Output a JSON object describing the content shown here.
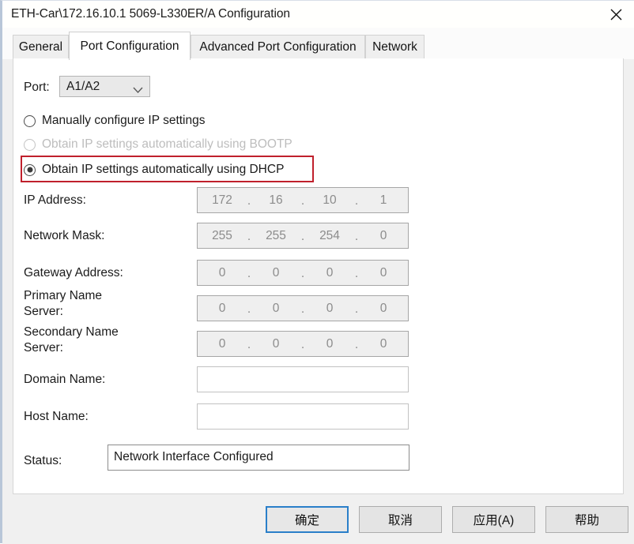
{
  "window": {
    "title": "ETH-Car\\172.16.10.1 5069-L330ER/A Configuration",
    "close_icon": "close-icon"
  },
  "tabs": [
    {
      "label": "General",
      "active": false
    },
    {
      "label": "Port Configuration",
      "active": true
    },
    {
      "label": "Advanced Port Configuration",
      "active": false
    },
    {
      "label": "Network",
      "active": false
    }
  ],
  "port": {
    "label": "Port:",
    "value": "A1/A2",
    "dropdown_icon": "chevron-down-icon"
  },
  "ip_mode": {
    "options": [
      {
        "label": "Manually configure IP settings",
        "selected": false,
        "disabled": false
      },
      {
        "label": "Obtain IP settings automatically using BOOTP",
        "selected": false,
        "disabled": true
      },
      {
        "label": "Obtain IP settings automatically using DHCP",
        "selected": true,
        "disabled": false
      }
    ],
    "highlight_color": "#c0202c"
  },
  "fields": {
    "ip_address": {
      "label": "IP Address:",
      "octets": [
        "172",
        "16",
        "10",
        "1"
      ],
      "readonly": true
    },
    "network_mask": {
      "label": "Network Mask:",
      "octets": [
        "255",
        "255",
        "254",
        "0"
      ],
      "readonly": true
    },
    "gateway_address": {
      "label": "Gateway Address:",
      "octets": [
        "0",
        "0",
        "0",
        "0"
      ],
      "readonly": true
    },
    "primary_name_server": {
      "label": "Primary Name\nServer:",
      "label_line1": "Primary Name",
      "label_line2": "Server:",
      "octets": [
        "0",
        "0",
        "0",
        "0"
      ],
      "readonly": true
    },
    "secondary_name_server": {
      "label_line1": "Secondary Name",
      "label_line2": "Server:",
      "octets": [
        "0",
        "0",
        "0",
        "0"
      ],
      "readonly": true
    },
    "domain_name": {
      "label": "Domain Name:",
      "value": "",
      "readonly": false
    },
    "host_name": {
      "label": "Host Name:",
      "value": "",
      "readonly": false
    }
  },
  "status": {
    "label": "Status:",
    "value": "Network Interface Configured"
  },
  "buttons": [
    {
      "label": "确定",
      "default": true
    },
    {
      "label": "取消",
      "default": false
    },
    {
      "label": "应用(A)",
      "default": false
    },
    {
      "label": "帮助",
      "default": false
    }
  ],
  "dot_separator": "."
}
